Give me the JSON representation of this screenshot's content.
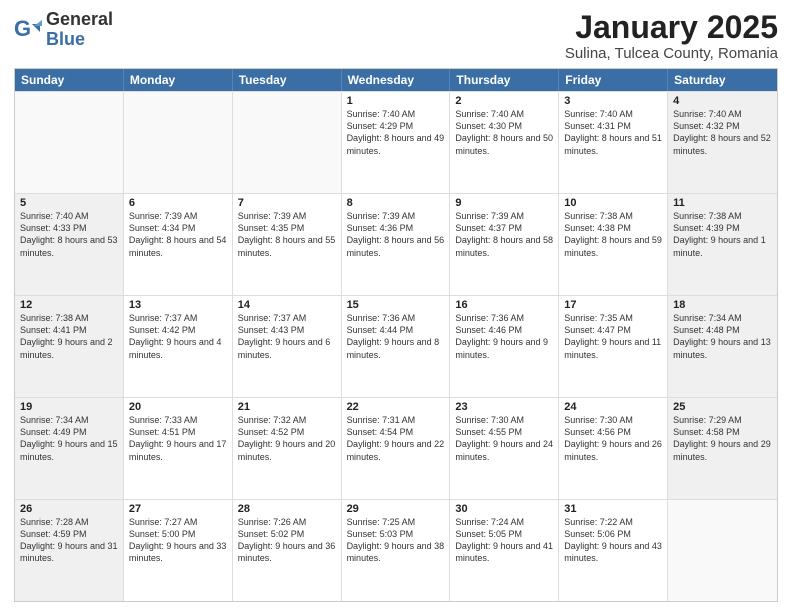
{
  "logo": {
    "general": "General",
    "blue": "Blue"
  },
  "header": {
    "month": "January 2025",
    "location": "Sulina, Tulcea County, Romania"
  },
  "weekdays": [
    "Sunday",
    "Monday",
    "Tuesday",
    "Wednesday",
    "Thursday",
    "Friday",
    "Saturday"
  ],
  "weeks": [
    [
      {
        "day": "",
        "sunrise": "",
        "sunset": "",
        "daylight": "",
        "shaded": false,
        "empty": true
      },
      {
        "day": "",
        "sunrise": "",
        "sunset": "",
        "daylight": "",
        "shaded": false,
        "empty": true
      },
      {
        "day": "",
        "sunrise": "",
        "sunset": "",
        "daylight": "",
        "shaded": false,
        "empty": true
      },
      {
        "day": "1",
        "sunrise": "Sunrise: 7:40 AM",
        "sunset": "Sunset: 4:29 PM",
        "daylight": "Daylight: 8 hours and 49 minutes.",
        "shaded": false,
        "empty": false
      },
      {
        "day": "2",
        "sunrise": "Sunrise: 7:40 AM",
        "sunset": "Sunset: 4:30 PM",
        "daylight": "Daylight: 8 hours and 50 minutes.",
        "shaded": false,
        "empty": false
      },
      {
        "day": "3",
        "sunrise": "Sunrise: 7:40 AM",
        "sunset": "Sunset: 4:31 PM",
        "daylight": "Daylight: 8 hours and 51 minutes.",
        "shaded": false,
        "empty": false
      },
      {
        "day": "4",
        "sunrise": "Sunrise: 7:40 AM",
        "sunset": "Sunset: 4:32 PM",
        "daylight": "Daylight: 8 hours and 52 minutes.",
        "shaded": true,
        "empty": false
      }
    ],
    [
      {
        "day": "5",
        "sunrise": "Sunrise: 7:40 AM",
        "sunset": "Sunset: 4:33 PM",
        "daylight": "Daylight: 8 hours and 53 minutes.",
        "shaded": true,
        "empty": false
      },
      {
        "day": "6",
        "sunrise": "Sunrise: 7:39 AM",
        "sunset": "Sunset: 4:34 PM",
        "daylight": "Daylight: 8 hours and 54 minutes.",
        "shaded": false,
        "empty": false
      },
      {
        "day": "7",
        "sunrise": "Sunrise: 7:39 AM",
        "sunset": "Sunset: 4:35 PM",
        "daylight": "Daylight: 8 hours and 55 minutes.",
        "shaded": false,
        "empty": false
      },
      {
        "day": "8",
        "sunrise": "Sunrise: 7:39 AM",
        "sunset": "Sunset: 4:36 PM",
        "daylight": "Daylight: 8 hours and 56 minutes.",
        "shaded": false,
        "empty": false
      },
      {
        "day": "9",
        "sunrise": "Sunrise: 7:39 AM",
        "sunset": "Sunset: 4:37 PM",
        "daylight": "Daylight: 8 hours and 58 minutes.",
        "shaded": false,
        "empty": false
      },
      {
        "day": "10",
        "sunrise": "Sunrise: 7:38 AM",
        "sunset": "Sunset: 4:38 PM",
        "daylight": "Daylight: 8 hours and 59 minutes.",
        "shaded": false,
        "empty": false
      },
      {
        "day": "11",
        "sunrise": "Sunrise: 7:38 AM",
        "sunset": "Sunset: 4:39 PM",
        "daylight": "Daylight: 9 hours and 1 minute.",
        "shaded": true,
        "empty": false
      }
    ],
    [
      {
        "day": "12",
        "sunrise": "Sunrise: 7:38 AM",
        "sunset": "Sunset: 4:41 PM",
        "daylight": "Daylight: 9 hours and 2 minutes.",
        "shaded": true,
        "empty": false
      },
      {
        "day": "13",
        "sunrise": "Sunrise: 7:37 AM",
        "sunset": "Sunset: 4:42 PM",
        "daylight": "Daylight: 9 hours and 4 minutes.",
        "shaded": false,
        "empty": false
      },
      {
        "day": "14",
        "sunrise": "Sunrise: 7:37 AM",
        "sunset": "Sunset: 4:43 PM",
        "daylight": "Daylight: 9 hours and 6 minutes.",
        "shaded": false,
        "empty": false
      },
      {
        "day": "15",
        "sunrise": "Sunrise: 7:36 AM",
        "sunset": "Sunset: 4:44 PM",
        "daylight": "Daylight: 9 hours and 8 minutes.",
        "shaded": false,
        "empty": false
      },
      {
        "day": "16",
        "sunrise": "Sunrise: 7:36 AM",
        "sunset": "Sunset: 4:46 PM",
        "daylight": "Daylight: 9 hours and 9 minutes.",
        "shaded": false,
        "empty": false
      },
      {
        "day": "17",
        "sunrise": "Sunrise: 7:35 AM",
        "sunset": "Sunset: 4:47 PM",
        "daylight": "Daylight: 9 hours and 11 minutes.",
        "shaded": false,
        "empty": false
      },
      {
        "day": "18",
        "sunrise": "Sunrise: 7:34 AM",
        "sunset": "Sunset: 4:48 PM",
        "daylight": "Daylight: 9 hours and 13 minutes.",
        "shaded": true,
        "empty": false
      }
    ],
    [
      {
        "day": "19",
        "sunrise": "Sunrise: 7:34 AM",
        "sunset": "Sunset: 4:49 PM",
        "daylight": "Daylight: 9 hours and 15 minutes.",
        "shaded": true,
        "empty": false
      },
      {
        "day": "20",
        "sunrise": "Sunrise: 7:33 AM",
        "sunset": "Sunset: 4:51 PM",
        "daylight": "Daylight: 9 hours and 17 minutes.",
        "shaded": false,
        "empty": false
      },
      {
        "day": "21",
        "sunrise": "Sunrise: 7:32 AM",
        "sunset": "Sunset: 4:52 PM",
        "daylight": "Daylight: 9 hours and 20 minutes.",
        "shaded": false,
        "empty": false
      },
      {
        "day": "22",
        "sunrise": "Sunrise: 7:31 AM",
        "sunset": "Sunset: 4:54 PM",
        "daylight": "Daylight: 9 hours and 22 minutes.",
        "shaded": false,
        "empty": false
      },
      {
        "day": "23",
        "sunrise": "Sunrise: 7:30 AM",
        "sunset": "Sunset: 4:55 PM",
        "daylight": "Daylight: 9 hours and 24 minutes.",
        "shaded": false,
        "empty": false
      },
      {
        "day": "24",
        "sunrise": "Sunrise: 7:30 AM",
        "sunset": "Sunset: 4:56 PM",
        "daylight": "Daylight: 9 hours and 26 minutes.",
        "shaded": false,
        "empty": false
      },
      {
        "day": "25",
        "sunrise": "Sunrise: 7:29 AM",
        "sunset": "Sunset: 4:58 PM",
        "daylight": "Daylight: 9 hours and 29 minutes.",
        "shaded": true,
        "empty": false
      }
    ],
    [
      {
        "day": "26",
        "sunrise": "Sunrise: 7:28 AM",
        "sunset": "Sunset: 4:59 PM",
        "daylight": "Daylight: 9 hours and 31 minutes.",
        "shaded": true,
        "empty": false
      },
      {
        "day": "27",
        "sunrise": "Sunrise: 7:27 AM",
        "sunset": "Sunset: 5:00 PM",
        "daylight": "Daylight: 9 hours and 33 minutes.",
        "shaded": false,
        "empty": false
      },
      {
        "day": "28",
        "sunrise": "Sunrise: 7:26 AM",
        "sunset": "Sunset: 5:02 PM",
        "daylight": "Daylight: 9 hours and 36 minutes.",
        "shaded": false,
        "empty": false
      },
      {
        "day": "29",
        "sunrise": "Sunrise: 7:25 AM",
        "sunset": "Sunset: 5:03 PM",
        "daylight": "Daylight: 9 hours and 38 minutes.",
        "shaded": false,
        "empty": false
      },
      {
        "day": "30",
        "sunrise": "Sunrise: 7:24 AM",
        "sunset": "Sunset: 5:05 PM",
        "daylight": "Daylight: 9 hours and 41 minutes.",
        "shaded": false,
        "empty": false
      },
      {
        "day": "31",
        "sunrise": "Sunrise: 7:22 AM",
        "sunset": "Sunset: 5:06 PM",
        "daylight": "Daylight: 9 hours and 43 minutes.",
        "shaded": false,
        "empty": false
      },
      {
        "day": "",
        "sunrise": "",
        "sunset": "",
        "daylight": "",
        "shaded": true,
        "empty": true
      }
    ]
  ]
}
